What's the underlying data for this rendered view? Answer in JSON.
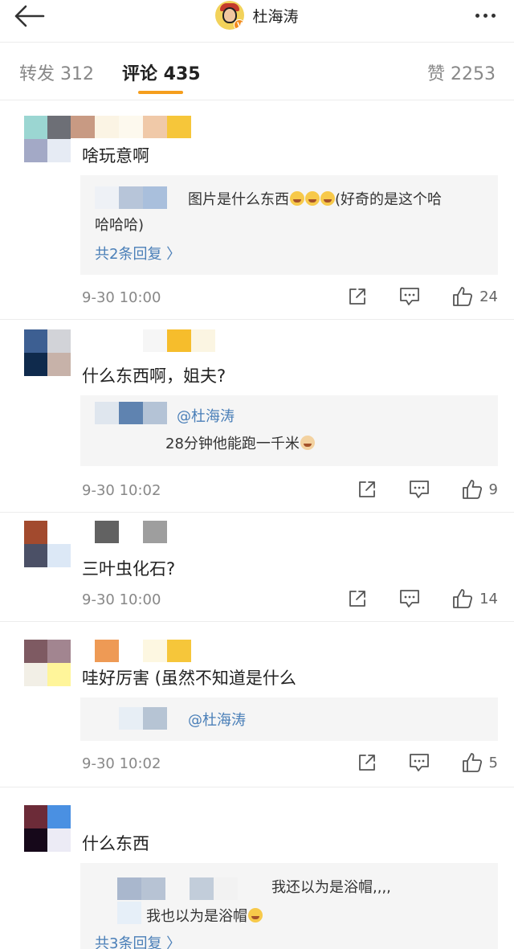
{
  "header": {
    "title": "杜海涛",
    "icons": {
      "back": "arrow-left-icon",
      "more": "more-dots-icon",
      "verified": "verified-badge-icon"
    },
    "verified_mark": "V"
  },
  "tabs": [
    {
      "label": "转发 312"
    },
    {
      "label": "评论 435"
    },
    {
      "label": "赞 2253"
    }
  ],
  "colors": {
    "accent": "#f59e1d",
    "link": "#4a7fb8",
    "reply_bg": "#f5f5f5"
  },
  "comments": [
    {
      "text": "啥玩意啊",
      "reply": {
        "text": "图片是什么东西",
        "text2": "(好奇的是这个哈",
        "text3": "哈哈哈)",
        "more": "共2条回复 〉"
      },
      "time": "9-30 10:00",
      "likes": "24"
    },
    {
      "text": "什么东西啊，姐夫?",
      "reply": {
        "mention": "@杜海涛",
        "text": "28分钟他能跑一千米"
      },
      "time": "9-30 10:02",
      "likes": "9"
    },
    {
      "text": "三叶虫化石?",
      "time": "9-30 10:00",
      "likes": "14"
    },
    {
      "text": "哇好厉害 (虽然不知道是什么",
      "reply": {
        "mention": "@杜海涛"
      },
      "time": "9-30 10:02",
      "likes": "5"
    },
    {
      "text": "什么东西",
      "reply": {
        "text": "我还以为是浴帽,,,,",
        "text2": "我也以为是浴帽",
        "more": "共3条回复 〉"
      }
    }
  ]
}
